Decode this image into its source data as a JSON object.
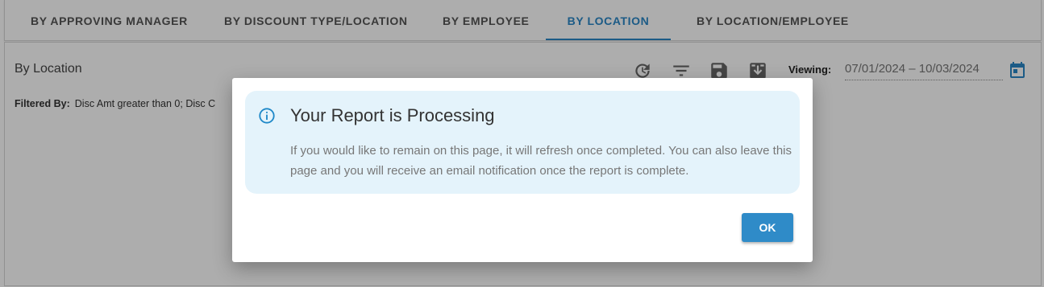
{
  "tabs": [
    {
      "label": "BY APPROVING MANAGER"
    },
    {
      "label": "BY DISCOUNT TYPE/LOCATION"
    },
    {
      "label": "BY EMPLOYEE"
    },
    {
      "label": "BY LOCATION"
    },
    {
      "label": "BY LOCATION/EMPLOYEE"
    }
  ],
  "active_tab": "BY LOCATION",
  "report": {
    "title": "By Location",
    "filtered_label": "Filtered By:",
    "filtered_value": "Disc Amt greater than 0; Disc C",
    "viewing_label": "Viewing:",
    "date_range": "07/01/2024 – 10/03/2024"
  },
  "toolbar_icons": [
    "refresh-icon",
    "filter-icon",
    "save-icon",
    "download-icon",
    "calendar-icon"
  ],
  "dialog": {
    "title": "Your Report is Processing",
    "message": "If you would like to remain on this page, it will refresh once completed. You can also leave this page and you will receive an email notification once the report is complete.",
    "ok_label": "OK"
  },
  "colors": {
    "accent": "#2a86c6",
    "alert_background": "#e4f3fb",
    "ok_button": "#2f8bc8",
    "overlay": "rgba(0,0,0,0.32)"
  }
}
